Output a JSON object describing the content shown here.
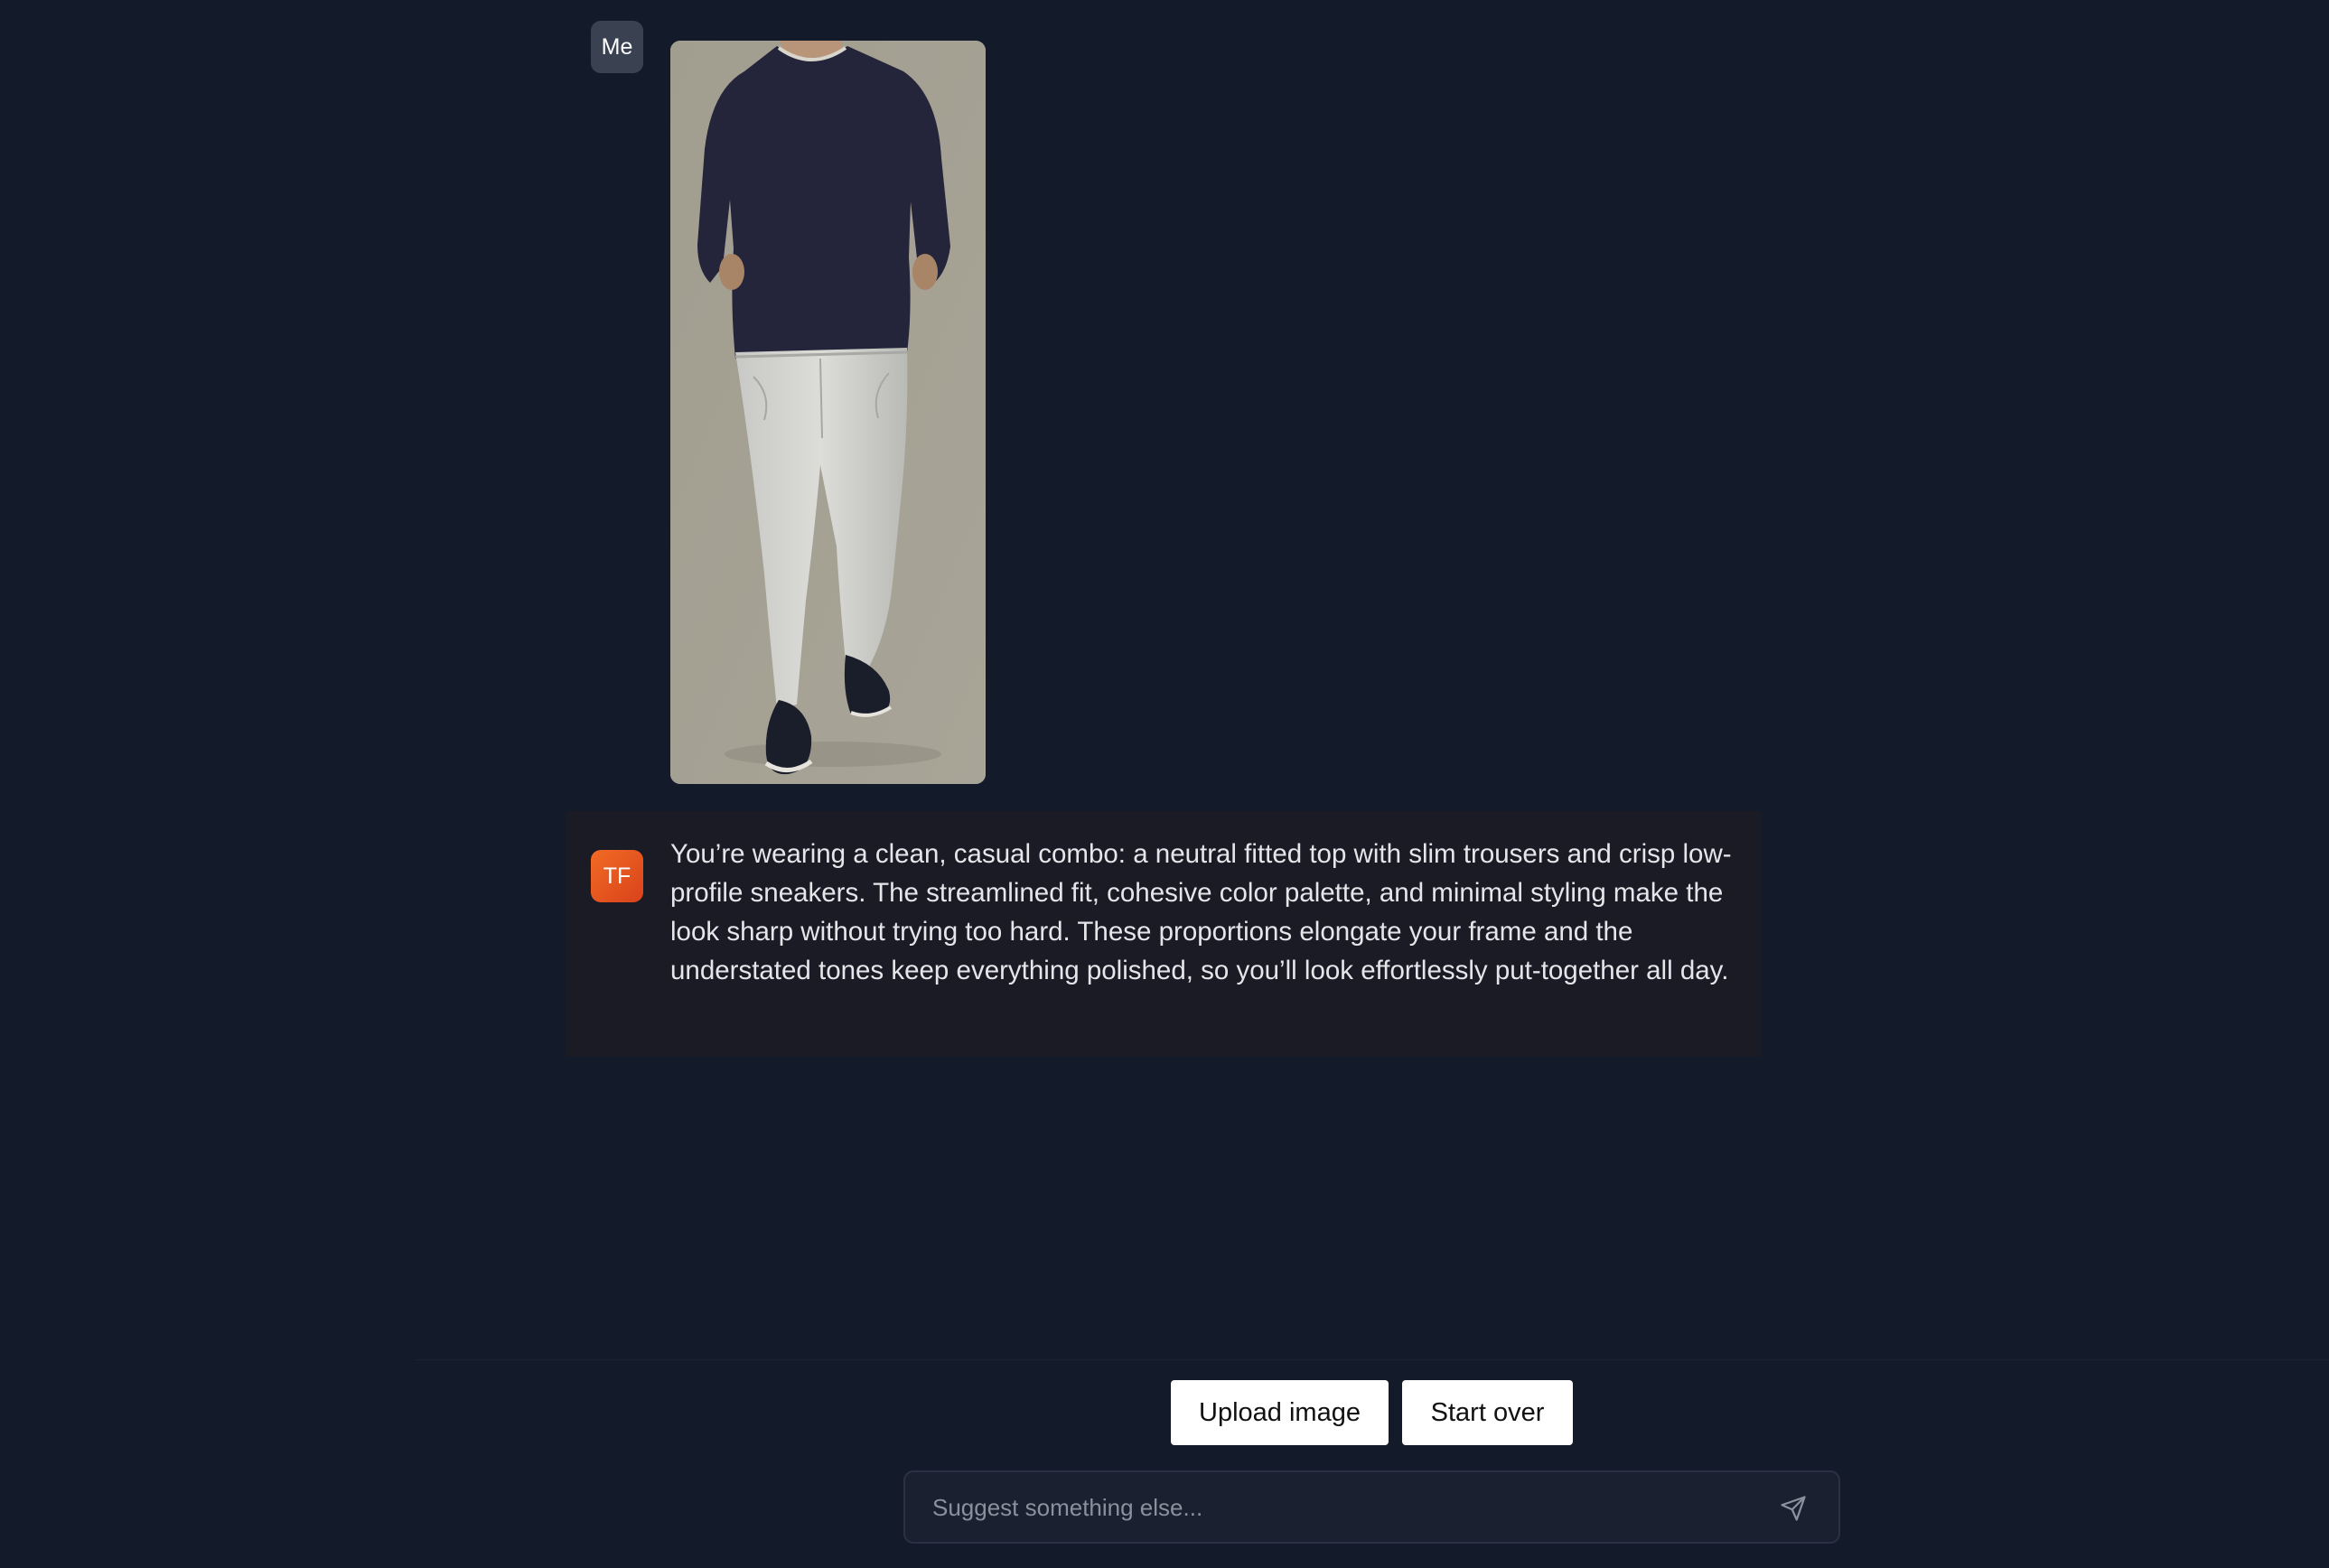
{
  "chat": {
    "user_avatar": "Me",
    "user_image_alt": "Full-body outfit photo: navy long-sleeve top, light grey slim jeans, dark slip-on sneakers",
    "assistant_avatar": "TF",
    "assistant_message": "You’re wearing a clean, casual combo: a neutral fitted top with slim trousers and crisp low-profile sneakers. The streamlined fit, cohesive color palette, and minimal styling make the look sharp without trying too hard. These proportions elongate your frame and the understated tones keep everything polished, so you’ll look effortlessly put-together all day."
  },
  "actions": {
    "upload_label": "Upload image",
    "start_over_label": "Start over"
  },
  "composer": {
    "placeholder": "Suggest something else...",
    "send_icon": "send-icon"
  },
  "colors": {
    "background": "#131a29",
    "assistant_bubble": "#1b1b26",
    "tf_avatar_accent": "#e8521f",
    "me_avatar": "#3a4252",
    "button_bg": "#ffffff"
  }
}
